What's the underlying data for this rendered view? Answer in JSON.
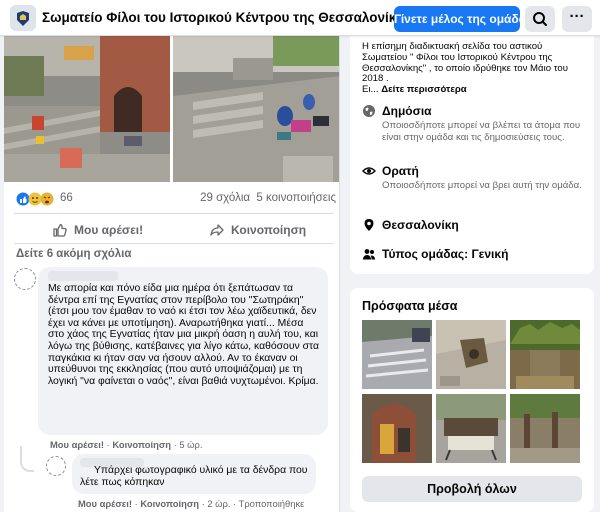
{
  "group": {
    "title": "Σωματείο Φίλοι του Ιστορικού Κέντρου της Θεσσαλονίκης",
    "join_label": "Γίνετε μέλος της ομάδας",
    "more_label": "···"
  },
  "post": {
    "reaction_count": "66",
    "comments_count": "29 σχόλια",
    "shares_count": "5 κοινοποιήσεις",
    "like_label": "Μου αρέσει!",
    "share_label": "Κοινοποίηση",
    "more_comments": "Δείτε 6 ακόμη σχόλια"
  },
  "comments": [
    {
      "text": "Με απορία και πόνο είδα μια ημέρα ότι ξεπάτωσαν τα δέντρα επί της Εγνατίας στον περίβολο του \"Σωτηράκη\" (έτσι μου τον έμαθαν το ναό κι έτσι τον λέω χαϊδευτικά, δεν έχει να κάνει με υποτίμηση). Αναρωτήθηκα γιατί... Μέσα στο χάος της Εγνατίας ήταν μια μικρή όαση η αυλή του, και λόγω της βύθισης, κατέβαινες για λίγο κάτω, καθόσουν στα παγκάκια κι ήταν σαν να ήσουν αλλού. Αν το έκαναν οι υπεύθυνοι της εκκλησίας (που αυτό υποψιάζομαι) με τη λογική \"να φαίνεται ο ναός\", είναι βαθιά νυχτωμένοι. Κρίμα.",
      "like": "Μου αρέσει!",
      "share": "Κοινοποίηση",
      "time": "5 ώρ."
    },
    {
      "text": "Υπάρχει φωτογραφικό υλικό με τα δένδρα που λέτε πως κόπηκαν",
      "like": "Μου αρέσει!",
      "share": "Κοινοποίηση",
      "time": "2 ώρ.",
      "edited": "Τροποποιήθηκε"
    }
  ],
  "about": {
    "intro_text": "Η επίσημη διαδικτυακή σελίδα του αστικού Σωματείου \" Φίλοι του Ιστορικού Κέντρου της Θεσσαλονίκης\" , το οποίο ιδρύθηκε τον Μάιο του 2018 .",
    "intro_tail": "Ει...",
    "see_more": "Δείτε περισσότερα",
    "public_title": "Δημόσια",
    "public_desc": "Οποιοσδήποτε μπορεί να βλέπει τα άτομα που είναι στην ομάδα και τις δημοσιεύσεις τους.",
    "visible_title": "Ορατή",
    "visible_desc": "Οποιοσδήποτε μπορεί να βρει αυτή την ομάδα.",
    "location": "Θεσσαλονίκη",
    "group_type": "Τύπος ομάδας: Γενική"
  },
  "media": {
    "title": "Πρόσφατα μέσα",
    "view_all": "Προβολή όλων"
  },
  "colors": {
    "accent": "#1877f2",
    "secondary_text": "#65676b",
    "bubble": "#f0f2f5"
  }
}
